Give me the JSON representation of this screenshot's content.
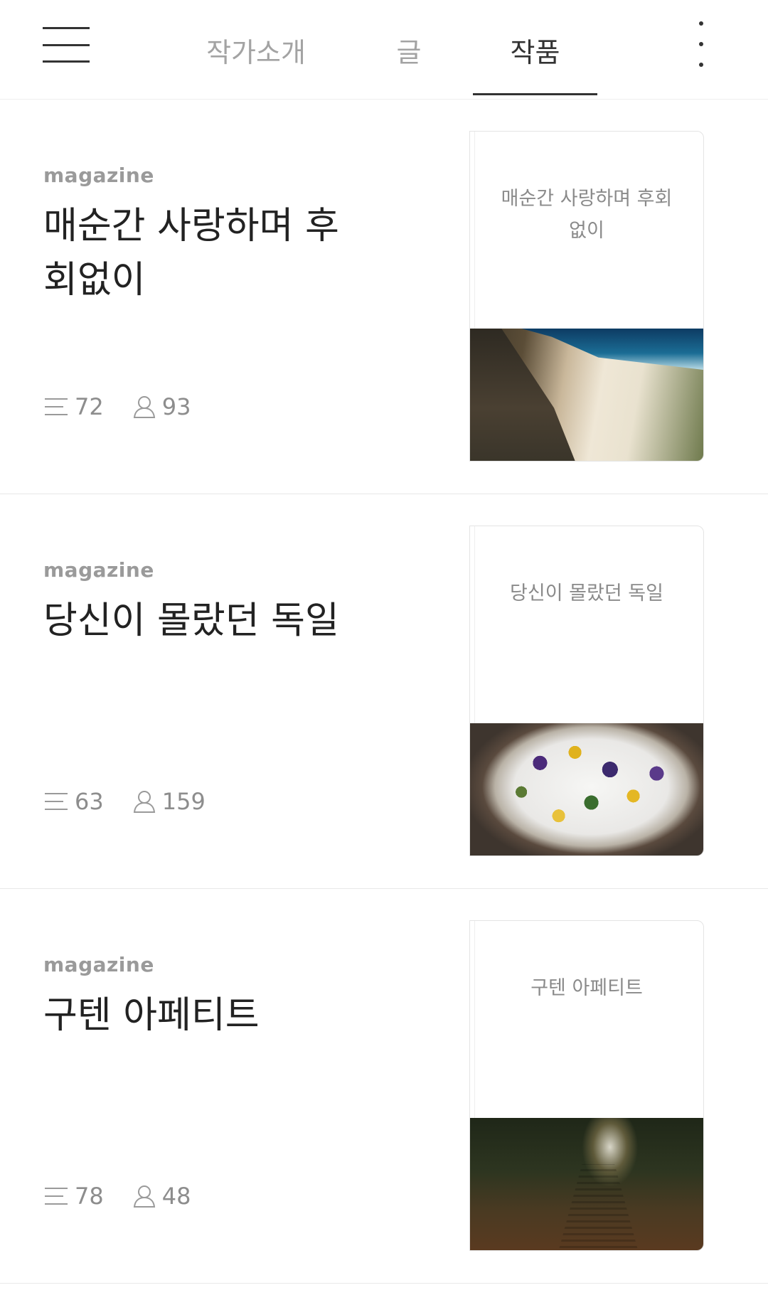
{
  "nav": {
    "tabs": [
      {
        "label": "작가소개",
        "active": false
      },
      {
        "label": "글",
        "active": false
      },
      {
        "label": "작품",
        "active": true
      }
    ],
    "menu_icon": "hamburger-menu-icon",
    "more_icon": "more-vertical-icon"
  },
  "items": [
    {
      "category": "magazine",
      "title": "매순간 사랑하며 후회없이",
      "cover_title": "매순간 사랑하며 후회없이",
      "posts_count": "72",
      "subscribers_count": "93",
      "photo": "beach"
    },
    {
      "category": "magazine",
      "title": "당신이 몰랐던 독일",
      "cover_title": "당신이 몰랐던 독일",
      "posts_count": "63",
      "subscribers_count": "159",
      "photo": "flowers-in-snow"
    },
    {
      "category": "magazine",
      "title": "구텐 아페티트",
      "cover_title": "구텐 아페티트",
      "posts_count": "78",
      "subscribers_count": "48",
      "photo": "forest-stairs"
    }
  ],
  "colors": {
    "text_primary": "#222222",
    "text_secondary": "#9a9a9a",
    "divider": "#e8e8e8"
  }
}
